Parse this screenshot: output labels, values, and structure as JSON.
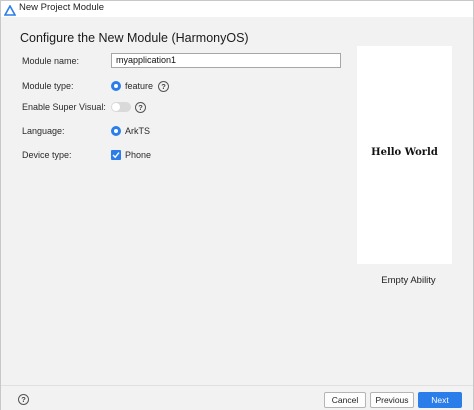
{
  "window": {
    "title": "New Project Module",
    "icon": "harmonyos-triangle-icon"
  },
  "page": {
    "heading": "Configure the New Module (HarmonyOS)"
  },
  "form": {
    "module_name": {
      "label": "Module name:",
      "value": "myapplication1"
    },
    "module_type": {
      "label": "Module type:",
      "selected": "feature"
    },
    "super_visual": {
      "label": "Enable Super Visual:",
      "enabled": false
    },
    "language": {
      "label": "Language:",
      "selected": "ArkTS"
    },
    "device_type": {
      "label": "Device type:",
      "option": "Phone",
      "checked": true
    }
  },
  "preview": {
    "text": "Hello World",
    "template_name": "Empty Ability"
  },
  "footer": {
    "help_glyph": "?",
    "cancel_label": "Cancel",
    "previous_label": "Previous",
    "next_label": "Next"
  },
  "help_glyph": "?",
  "colors": {
    "accent": "#2b7de9",
    "background": "#f2f2f2",
    "toggle_off": "#d9d9d9"
  }
}
